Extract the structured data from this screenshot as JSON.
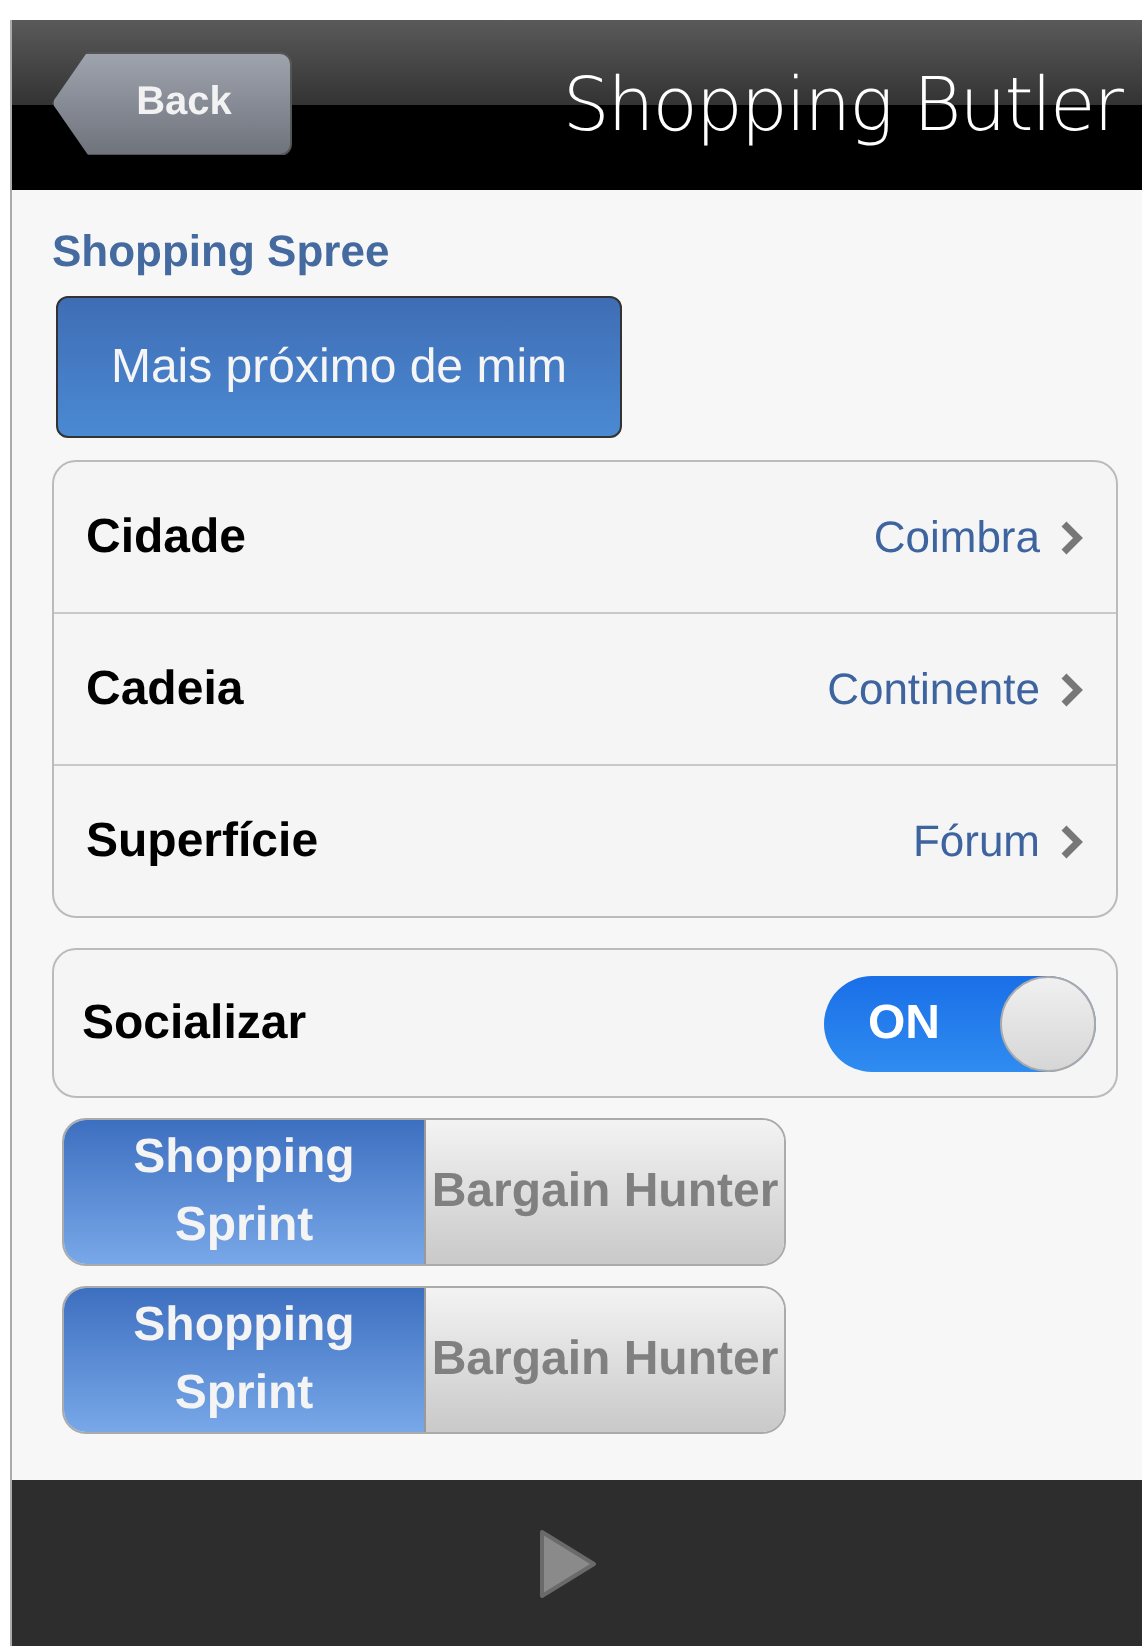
{
  "nav_bar": {
    "back_button": "Back",
    "title": "Shopping Butler"
  },
  "section_title": "Shopping Spree",
  "nearest_button": "Mais próximo de mim",
  "settings": [
    {
      "label": "Cidade",
      "value": "Coimbra"
    },
    {
      "label": "Cadeia",
      "value": "Continente"
    },
    {
      "label": "Superfície",
      "value": "Fórum"
    }
  ],
  "toggle": {
    "label": "Socializar",
    "on": true,
    "on_text": "ON"
  },
  "segmented_controls": [
    [
      {
        "label": "Shopping Sprint",
        "selected": true
      },
      {
        "label": "Bargain Hunter",
        "selected": false
      }
    ],
    [
      {
        "label": "Shopping Sprint",
        "selected": true
      },
      {
        "label": "Bargain Hunter",
        "selected": false
      }
    ]
  ]
}
